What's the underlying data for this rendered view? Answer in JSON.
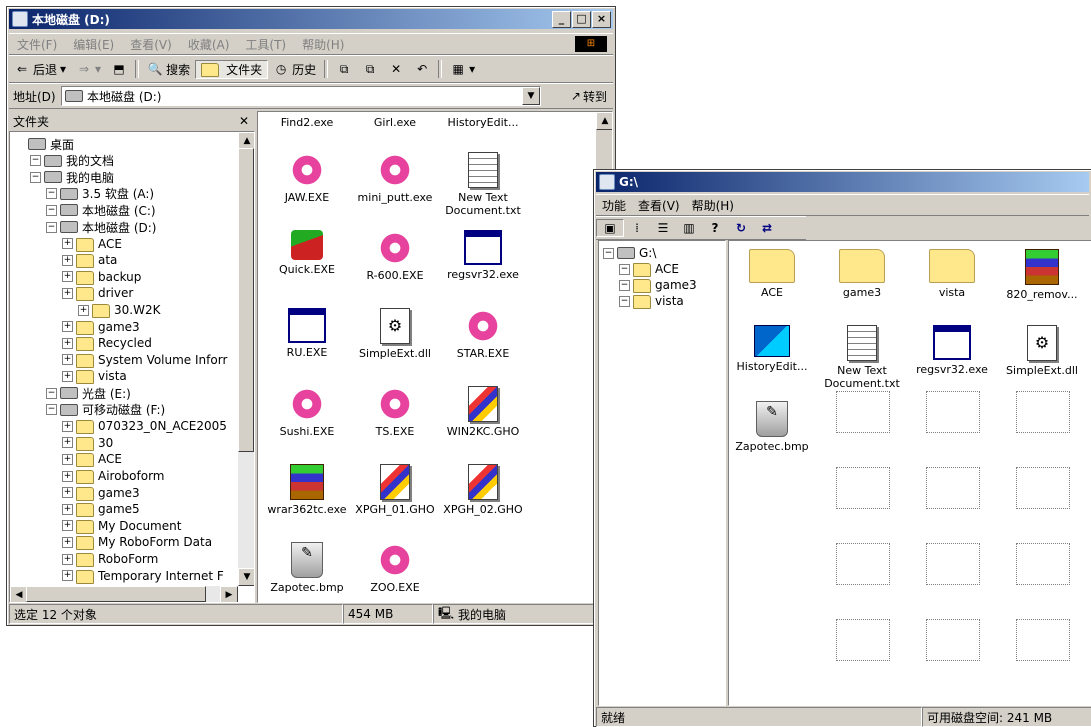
{
  "win1": {
    "title": "本地磁盘 (D:)",
    "menu": [
      "文件(F)",
      "编辑(E)",
      "查看(V)",
      "收藏(A)",
      "工具(T)",
      "帮助(H)"
    ],
    "toolbar": {
      "back": "后退",
      "search": "搜索",
      "folders": "文件夹",
      "history": "历史"
    },
    "address_label": "地址(D)",
    "address_value": "本地磁盘 (D:)",
    "go_label": "转到",
    "folders_pane_title": "文件夹",
    "tree": [
      {
        "label": "桌面",
        "level": 0
      },
      {
        "label": "我的文档",
        "level": 1
      },
      {
        "label": "我的电脑",
        "level": 1
      },
      {
        "label": "3.5 软盘 (A:)",
        "level": 2
      },
      {
        "label": "本地磁盘 (C:)",
        "level": 2
      },
      {
        "label": "本地磁盘 (D:)",
        "level": 2
      },
      {
        "label": "ACE",
        "level": 3
      },
      {
        "label": "ata",
        "level": 3
      },
      {
        "label": "backup",
        "level": 3
      },
      {
        "label": "driver",
        "level": 3
      },
      {
        "label": "30.W2K",
        "level": 4
      },
      {
        "label": "game3",
        "level": 3
      },
      {
        "label": "Recycled",
        "level": 3
      },
      {
        "label": "System Volume Inforr",
        "level": 3
      },
      {
        "label": "vista",
        "level": 3
      },
      {
        "label": "光盘 (E:)",
        "level": 2
      },
      {
        "label": "可移动磁盘 (F:)",
        "level": 2
      },
      {
        "label": "070323_0N_ACE2005",
        "level": 3
      },
      {
        "label": "30",
        "level": 3
      },
      {
        "label": "ACE",
        "level": 3
      },
      {
        "label": "Airoboform",
        "level": 3
      },
      {
        "label": "game3",
        "level": 3
      },
      {
        "label": "game5",
        "level": 3
      },
      {
        "label": "My Document",
        "level": 3
      },
      {
        "label": "My RoboForm Data",
        "level": 3
      },
      {
        "label": "RoboForm",
        "level": 3
      },
      {
        "label": "Temporary Internet F",
        "level": 3
      }
    ],
    "files": [
      {
        "name": "Find2.exe",
        "icon": "none"
      },
      {
        "name": "Girl.exe",
        "icon": "none"
      },
      {
        "name": "HistoryEdit...",
        "icon": "none"
      },
      {
        "name": "JAW.EXE",
        "icon": "star"
      },
      {
        "name": "mini_putt.exe",
        "icon": "star"
      },
      {
        "name": "New Text Document.txt",
        "icon": "doc"
      },
      {
        "name": "Quick.EXE",
        "icon": "quick"
      },
      {
        "name": "R-600.EXE",
        "icon": "star"
      },
      {
        "name": "regsvr32.exe",
        "icon": "app"
      },
      {
        "name": "RU.EXE",
        "icon": "app"
      },
      {
        "name": "SimpleExt.dll",
        "icon": "dll"
      },
      {
        "name": "STAR.EXE",
        "icon": "star"
      },
      {
        "name": "Sushi.EXE",
        "icon": "star"
      },
      {
        "name": "TS.EXE",
        "icon": "star"
      },
      {
        "name": "WIN2KC.GHO",
        "icon": "gho"
      },
      {
        "name": "wrar362tc.exe",
        "icon": "rar"
      },
      {
        "name": "XPGH_01.GHO",
        "icon": "gho"
      },
      {
        "name": "XPGH_02.GHO",
        "icon": "gho"
      },
      {
        "name": "Zapotec.bmp",
        "icon": "bmp"
      },
      {
        "name": "ZOO.EXE",
        "icon": "star"
      }
    ],
    "status": {
      "selection": "选定 12 个对象",
      "size": "454 MB",
      "location": "我的电脑"
    }
  },
  "win2": {
    "title": "G:\\",
    "menu": [
      "功能",
      "查看(V)",
      "帮助(H)"
    ],
    "tree": [
      {
        "label": "G:\\",
        "level": 0
      },
      {
        "label": "ACE",
        "level": 1
      },
      {
        "label": "game3",
        "level": 1
      },
      {
        "label": "vista",
        "level": 1
      }
    ],
    "files": [
      {
        "name": "ACE",
        "icon": "folder"
      },
      {
        "name": "game3",
        "icon": "folder"
      },
      {
        "name": "vista",
        "icon": "folder"
      },
      {
        "name": "820_remov...",
        "icon": "rar"
      },
      {
        "name": "HistoryEdit...",
        "icon": "hist"
      },
      {
        "name": "New Text Document.txt",
        "icon": "doc"
      },
      {
        "name": "regsvr32.exe",
        "icon": "app"
      },
      {
        "name": "SimpleExt.dll",
        "icon": "dll"
      },
      {
        "name": "Zapotec.bmp",
        "icon": "bmp"
      }
    ],
    "status": {
      "left": "就绪",
      "right": "可用磁盘空间: 241 MB"
    }
  }
}
